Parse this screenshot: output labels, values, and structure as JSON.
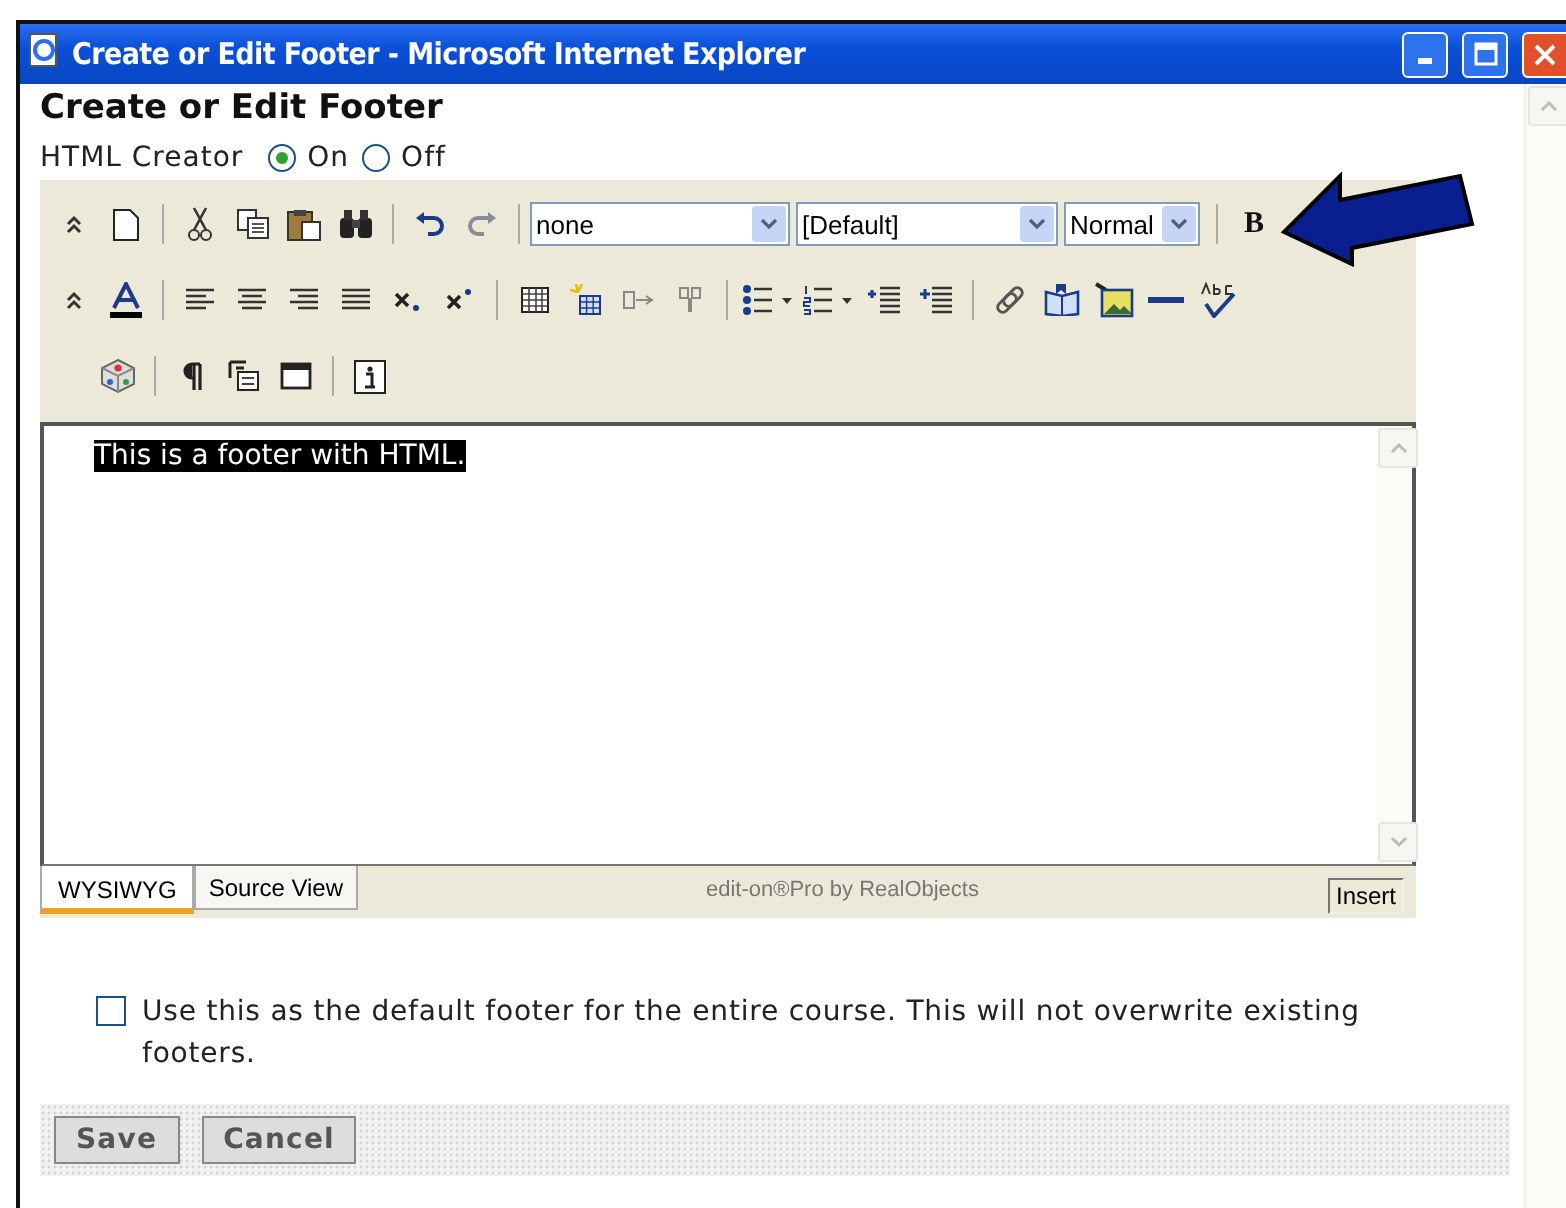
{
  "window": {
    "title": "Create or Edit Footer - Microsoft Internet Explorer"
  },
  "heading": "Create or Edit Footer",
  "html_creator": {
    "label": "HTML Creator",
    "options": [
      {
        "label": "On",
        "selected": true
      },
      {
        "label": "Off",
        "selected": false
      }
    ]
  },
  "toolbar": {
    "selects": [
      {
        "value": "none"
      },
      {
        "value": "[Default]"
      },
      {
        "value": "Normal"
      }
    ],
    "bold_label": "B"
  },
  "editor": {
    "content": "This is a footer with HTML.",
    "content_selected": true
  },
  "editor_tabs": [
    {
      "label": "WYSIWYG",
      "selected": true
    },
    {
      "label": "Source View",
      "selected": false
    }
  ],
  "editor_status": {
    "credit": "edit-on®Pro by RealObjects",
    "mode": "Insert"
  },
  "default_footer": {
    "label": "Use this as the default footer for the entire course. This will not overwrite existing footers.",
    "checked": false
  },
  "buttons": [
    "Save",
    "Cancel"
  ]
}
